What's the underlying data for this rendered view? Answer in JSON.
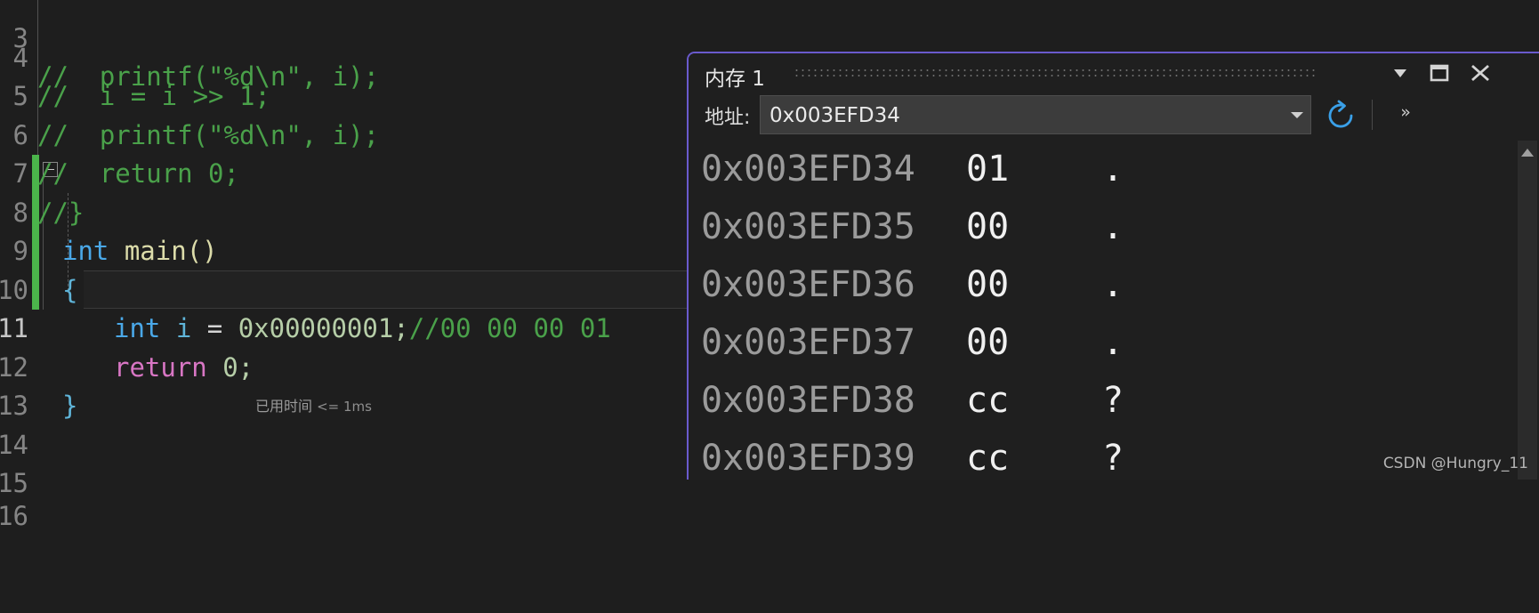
{
  "editor": {
    "background": "#1e1e1e",
    "change_bar_color": "#4bb44b",
    "lines": [
      {
        "num": "3",
        "text": "//  printf(\"%d\\n\", i);",
        "kind": "comment",
        "clipped_top": true
      },
      {
        "num": "4",
        "text": "//  i = i >> 1;",
        "kind": "comment"
      },
      {
        "num": "5",
        "text": "//  printf(\"%d\\n\", i);",
        "kind": "comment"
      },
      {
        "num": "6",
        "text": "//  return 0;",
        "kind": "comment"
      },
      {
        "num": "7",
        "text": "//}",
        "kind": "comment"
      },
      {
        "num": "8",
        "text": "int main()",
        "kind": "signature"
      },
      {
        "num": "9",
        "text": "{",
        "kind": "brace"
      },
      {
        "num": "10",
        "text": "    int i = 0x00000001;//00 00 00 01",
        "kind": "declaration"
      },
      {
        "num": "11",
        "text": "    return 0;",
        "kind": "return",
        "active": true
      },
      {
        "num": "12",
        "text": "}",
        "kind": "brace"
      },
      {
        "num": "13",
        "text": "",
        "kind": "empty"
      },
      {
        "num": "14",
        "text": "",
        "kind": "empty"
      },
      {
        "num": "15",
        "text": "",
        "kind": "empty"
      },
      {
        "num": "16",
        "text": "",
        "kind": "empty"
      }
    ],
    "tokens": {
      "signature_kw": "int",
      "signature_fn": " main()",
      "decl_kw": "int",
      "decl_var": " i ",
      "decl_eq": "= ",
      "decl_num": "0x00000001;",
      "decl_cmt": "//00 00 00 01",
      "return_kw": "return",
      "return_val": " 0;"
    },
    "inline_hint": {
      "label": "已用时间",
      "value": "<= 1ms"
    }
  },
  "memory_window": {
    "title": "内存 1",
    "border_color": "#6a5acd",
    "titlebar_buttons": [
      {
        "name": "dropdown",
        "glyph": "chevron-down"
      },
      {
        "name": "maximize",
        "glyph": "square"
      },
      {
        "name": "close",
        "glyph": "x"
      }
    ],
    "toolbar": {
      "address_label": "地址:",
      "address_value": "0x003EFD34",
      "address_placeholder": "0x003EFD34",
      "refresh_title": "refresh",
      "overflow_glyph": "»"
    },
    "columns": [
      "address",
      "hex",
      "ascii"
    ],
    "rows": [
      {
        "address": "0x003EFD34",
        "hex": "01",
        "ascii": "."
      },
      {
        "address": "0x003EFD35",
        "hex": "00",
        "ascii": "."
      },
      {
        "address": "0x003EFD36",
        "hex": "00",
        "ascii": "."
      },
      {
        "address": "0x003EFD37",
        "hex": "00",
        "ascii": "."
      },
      {
        "address": "0x003EFD38",
        "hex": "cc",
        "ascii": "?"
      },
      {
        "address": "0x003EFD39",
        "hex": "cc",
        "ascii": "?"
      }
    ]
  },
  "watermark": "CSDN @Hungry_11"
}
